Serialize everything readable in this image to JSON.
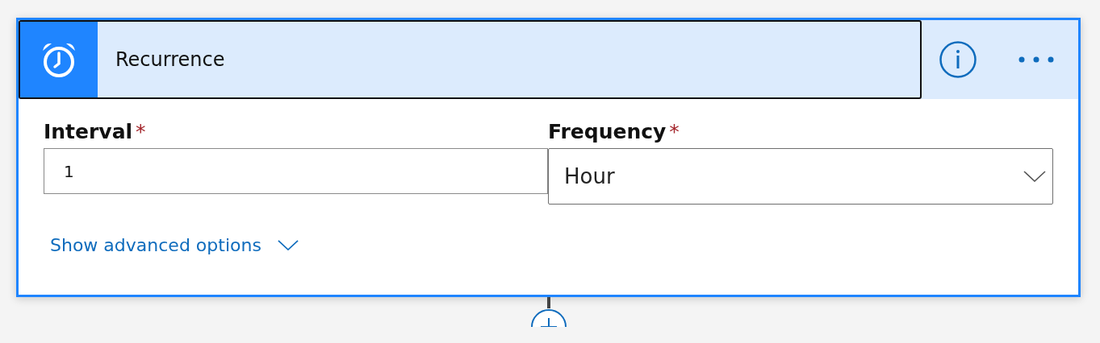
{
  "card": {
    "title": "Recurrence",
    "fields": [
      {
        "kind": "text",
        "label": "Interval",
        "required_mark": "*",
        "value": "1"
      },
      {
        "kind": "dropdown",
        "label": "Frequency",
        "required_mark": "*",
        "value": "Hour"
      }
    ],
    "advanced_link": "Show advanced options"
  }
}
